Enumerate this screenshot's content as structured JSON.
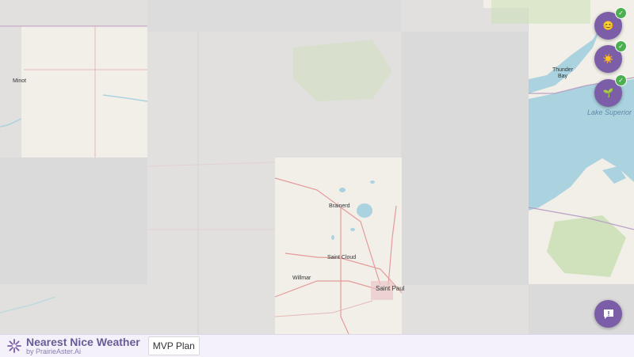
{
  "app": {
    "title": "Nearest Nice Weather",
    "subtitle": "by PrairieAster.Ai",
    "mvp_button": "MVP Plan"
  },
  "map": {
    "place_labels": {
      "minot": "Minot",
      "thunder_bay": "Thunder Bay",
      "lake_superior": "Lake Superior",
      "brainerd": "Brainerd",
      "saint_cloud": "Saint Cloud",
      "willmar": "Willmar",
      "saint_paul": "Saint Paul"
    }
  },
  "filters": [
    {
      "name": "mood",
      "icon": "smiley-icon",
      "glyph": "😊",
      "selected": true
    },
    {
      "name": "weather",
      "icon": "sun-icon",
      "glyph": "☀️",
      "selected": true
    },
    {
      "name": "activity",
      "icon": "seedling-icon",
      "glyph": "🌱",
      "selected": true
    }
  ],
  "check_glyph": "✓",
  "colors": {
    "accent": "#7b5ea7",
    "check": "#4caf50",
    "water": "#aad3df",
    "forest": "#c8dfb0"
  }
}
